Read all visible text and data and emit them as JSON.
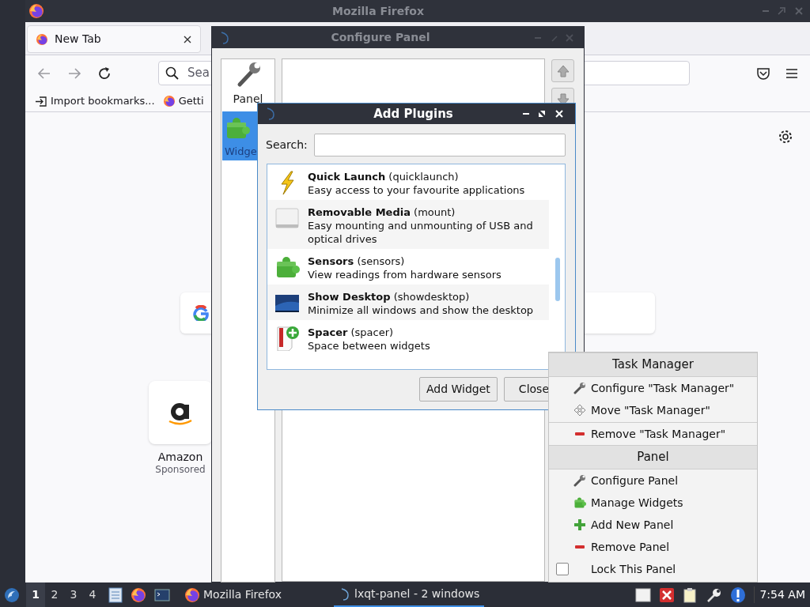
{
  "firefox": {
    "title": "Mozilla Firefox",
    "tabs": [
      {
        "label": "New Tab",
        "selected": true
      }
    ],
    "search_placeholder": "Sea",
    "bookmarks": [
      {
        "label": "Import bookmarks...",
        "kind": "import"
      },
      {
        "label": "Getti",
        "kind": "firefox"
      }
    ],
    "shortcuts": [
      {
        "label": "Amazon",
        "sublabel": "Sponsored"
      }
    ]
  },
  "configure_panel": {
    "title": "Configure Panel",
    "sidebar": [
      {
        "label": "Panel",
        "kind": "wrench",
        "selected": false
      },
      {
        "label": "Widge",
        "kind": "puzzle",
        "selected": true
      }
    ]
  },
  "add_plugins": {
    "title": "Add Plugins",
    "search_label": "Search:",
    "plugins": [
      {
        "title": "**Quick Launch** (quicklaunch)",
        "description": "Easy access to your favourite applications",
        "kind": "bolt"
      },
      {
        "title": "**Removable Media** (mount)",
        "description": "Easy mounting and unmounting of USB and optical drives",
        "kind": "drive"
      },
      {
        "title": "**Sensors** (sensors)",
        "description": "View readings from hardware sensors",
        "kind": "puzzle"
      },
      {
        "title": "**Show Desktop** (showdesktop)",
        "description": "Minimize all windows and show the desktop",
        "kind": "desktop"
      },
      {
        "title": "**Spacer** (spacer)",
        "description": "Space between widgets",
        "kind": "spacer"
      }
    ],
    "buttons": [
      "Add Widget",
      "Close"
    ]
  },
  "context_menu": [
    {
      "header": "Task Manager",
      "items": [
        {
          "label": "Configure \"Task Manager\"",
          "kind": "configure"
        },
        {
          "label": "Move \"Task Manager\"",
          "kind": "move"
        },
        {
          "label": "Remove \"Task Manager\"",
          "kind": "remove",
          "separator_before": true
        }
      ]
    },
    {
      "header": "Panel",
      "items": [
        {
          "label": "Configure Panel",
          "kind": "configure"
        },
        {
          "label": "Manage Widgets",
          "kind": "widgets"
        },
        {
          "label": "Add New Panel",
          "kind": "add"
        },
        {
          "label": "Remove Panel",
          "kind": "remove"
        },
        {
          "label": "Lock This Panel",
          "kind": "checkbox",
          "checked": false
        }
      ]
    }
  ],
  "taskbar": {
    "desktops": [
      {
        "label": "1",
        "selected": true
      },
      {
        "label": "2",
        "selected": false
      },
      {
        "label": "3",
        "selected": false
      },
      {
        "label": "4",
        "selected": false
      }
    ],
    "tasks": [
      {
        "label": "Mozilla Firefox",
        "kind": "firefox",
        "selected": false
      },
      {
        "label": "lxqt-panel - 2 windows",
        "kind": "lxqt",
        "selected": true
      }
    ],
    "clock": "7:54 AM"
  }
}
